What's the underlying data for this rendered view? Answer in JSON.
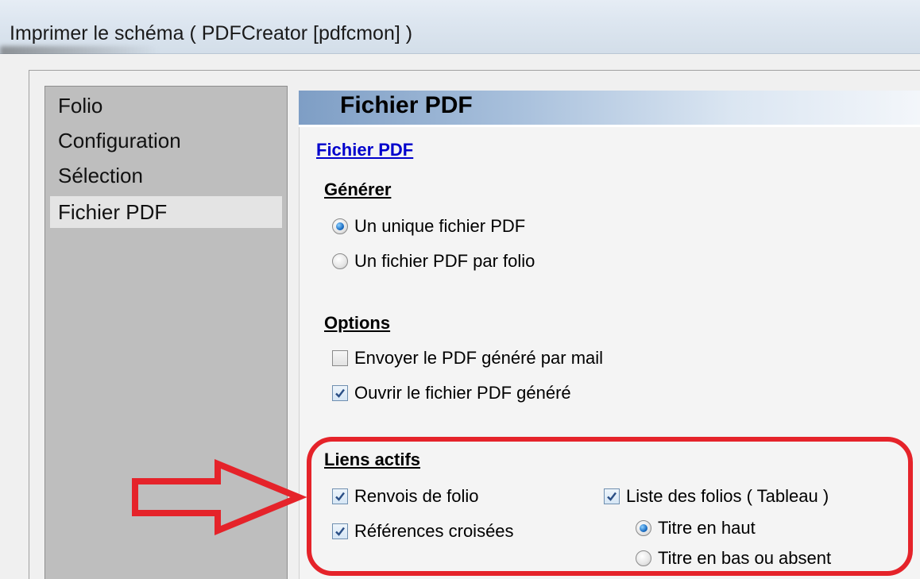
{
  "window": {
    "title": "Imprimer le schéma ( PDFCreator [pdfcmon] )"
  },
  "nav": {
    "items": [
      {
        "label": "Folio",
        "selected": false
      },
      {
        "label": "Configuration",
        "selected": false
      },
      {
        "label": "Sélection",
        "selected": false
      },
      {
        "label": "Fichier PDF",
        "selected": true
      }
    ]
  },
  "panel": {
    "header_title": "Fichier PDF",
    "link_title": "Fichier PDF",
    "generate": {
      "title": "Générer",
      "options": [
        {
          "label": "Un unique fichier PDF",
          "selected": true
        },
        {
          "label": "Un fichier PDF par folio",
          "selected": false
        }
      ]
    },
    "options": {
      "title": "Options",
      "items": [
        {
          "label": "Envoyer le PDF généré par mail",
          "checked": false
        },
        {
          "label": "Ouvrir le fichier PDF généré",
          "checked": true
        }
      ]
    },
    "links": {
      "title": "Liens actifs",
      "renvois": {
        "label": "Renvois de folio",
        "checked": true
      },
      "references": {
        "label": "Références croisées",
        "checked": true
      },
      "liste": {
        "label": "Liste des folios ( Tableau )",
        "checked": true
      },
      "title_position": [
        {
          "label": "Titre en haut",
          "selected": true
        },
        {
          "label": "Titre en bas ou absent",
          "selected": false
        }
      ]
    }
  },
  "annotation": {
    "color": "#e5232a"
  }
}
